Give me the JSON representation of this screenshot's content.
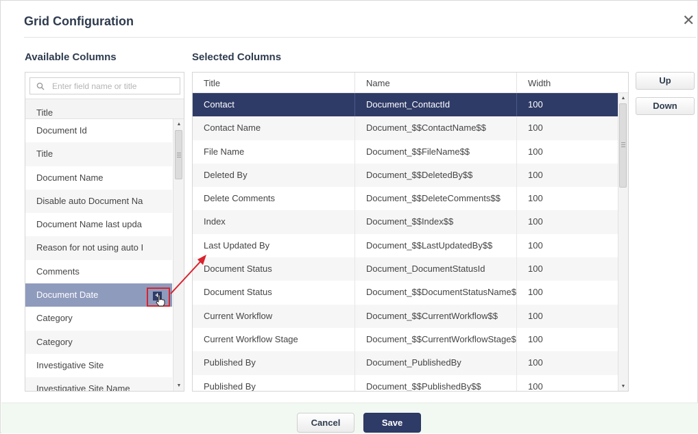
{
  "dialog": {
    "title": "Grid Configuration",
    "close_icon": "close-icon"
  },
  "available": {
    "label": "Available Columns",
    "search_placeholder": "Enter field name or title",
    "header": "Title",
    "highlighted_index": 7,
    "items": [
      "Document Id",
      "Title",
      "Document Name",
      "Disable auto Document Na",
      "Document Name last upda",
      "Reason for not using auto I",
      "Comments",
      "Document Date",
      "Category",
      "Category",
      "Investigative Site",
      "Investigative Site Name"
    ],
    "add_icon": "plus-square-icon",
    "cursor_icon": "hand-pointer-icon"
  },
  "selected": {
    "label": "Selected Columns",
    "columns": [
      "Title",
      "Name",
      "Width"
    ],
    "selected_index": 0,
    "rows": [
      {
        "title": "Contact",
        "name": "Document_ContactId",
        "width": "100"
      },
      {
        "title": "Contact Name",
        "name": "Document_$$ContactName$$",
        "width": "100"
      },
      {
        "title": "File Name",
        "name": "Document_$$FileName$$",
        "width": "100"
      },
      {
        "title": "Deleted By",
        "name": "Document_$$DeletedBy$$",
        "width": "100"
      },
      {
        "title": "Delete Comments",
        "name": "Document_$$DeleteComments$$",
        "width": "100"
      },
      {
        "title": "Index",
        "name": "Document_$$Index$$",
        "width": "100"
      },
      {
        "title": "Last Updated By",
        "name": "Document_$$LastUpdatedBy$$",
        "width": "100"
      },
      {
        "title": "Document Status",
        "name": "Document_DocumentStatusId",
        "width": "100"
      },
      {
        "title": "Document Status",
        "name": "Document_$$DocumentStatusName$",
        "width": "100"
      },
      {
        "title": "Current Workflow",
        "name": "Document_$$CurrentWorkflow$$",
        "width": "100"
      },
      {
        "title": "Current Workflow Stage",
        "name": "Document_$$CurrentWorkflowStage$",
        "width": "100"
      },
      {
        "title": "Published By",
        "name": "Document_PublishedBy",
        "width": "100"
      },
      {
        "title": "Published By",
        "name": "Document_$$PublishedBy$$",
        "width": "100"
      }
    ]
  },
  "actions": {
    "up": "Up",
    "down": "Down",
    "cancel": "Cancel",
    "save": "Save"
  },
  "colors": {
    "accent_dark": "#2f3b67",
    "highlight": "#8f9bbd",
    "annotation_red": "#d9232d"
  }
}
